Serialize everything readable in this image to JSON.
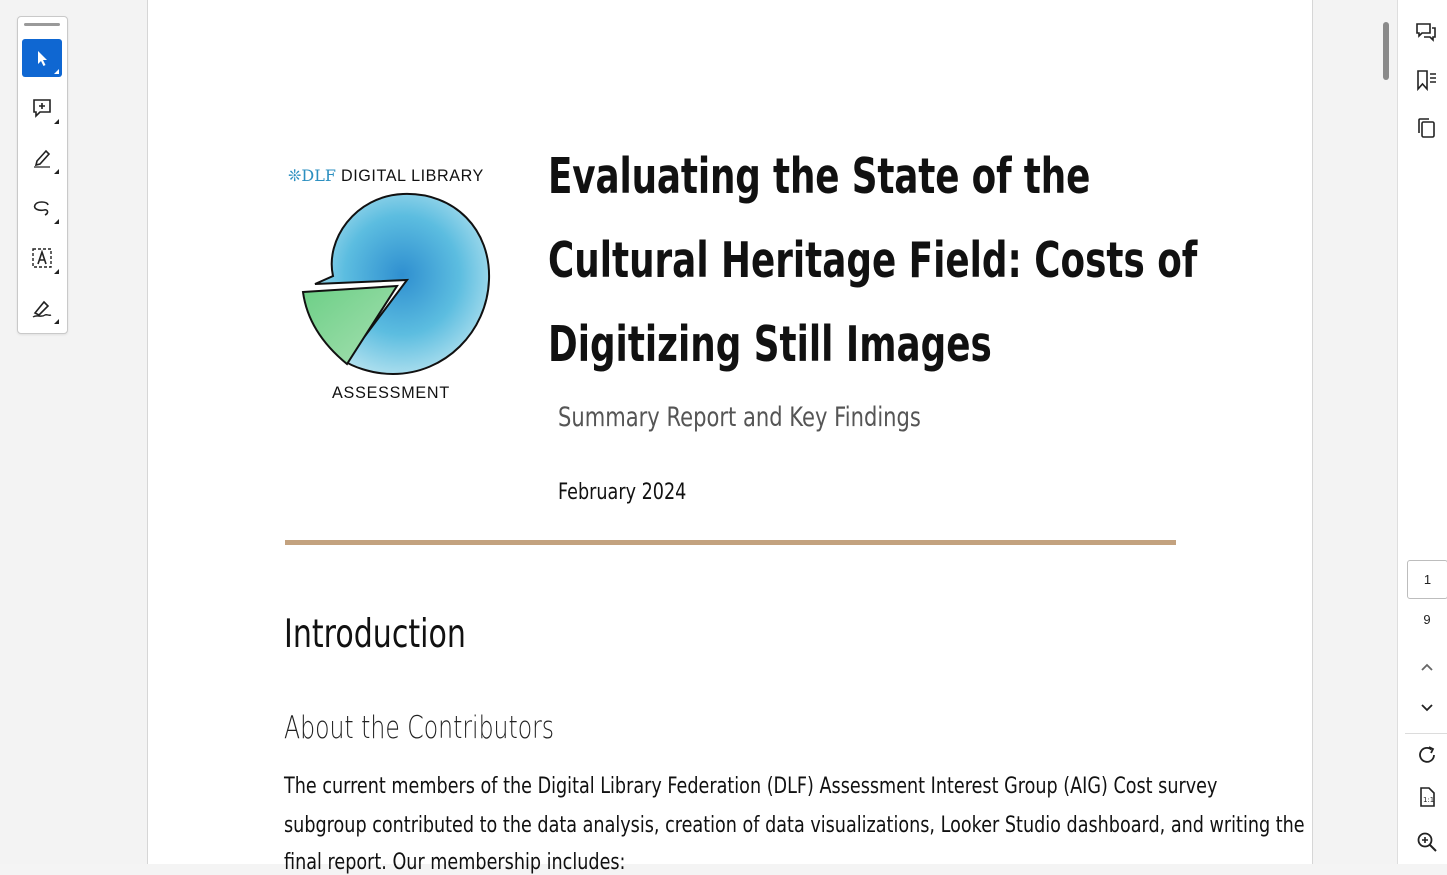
{
  "toolbar": {
    "tools": [
      {
        "name": "select",
        "icon": "cursor-icon",
        "active": true
      },
      {
        "name": "add-comment",
        "icon": "comment-plus-icon"
      },
      {
        "name": "highlight",
        "icon": "highlighter-icon"
      },
      {
        "name": "draw",
        "icon": "freehand-draw-icon"
      },
      {
        "name": "text-select",
        "icon": "text-box-icon"
      },
      {
        "name": "sign",
        "icon": "pen-sign-icon"
      }
    ]
  },
  "right_panel": {
    "icons": [
      "comments-icon",
      "bookmarks-icon",
      "page-thumbnails-icon"
    ],
    "current_page": "1",
    "total_pages": "9",
    "bottom_icons": [
      "chevron-up-icon",
      "chevron-down-icon",
      "rotate-icon",
      "fit-page-icon",
      "zoom-in-icon"
    ]
  },
  "document": {
    "logo": {
      "org_mark": "❊DLF",
      "org_name": "DIGITAL LIBRARY",
      "caption": "ASSESSMENT",
      "colors": {
        "circle": "#5fb8dc",
        "slice": "#7ccf8c"
      }
    },
    "title_lines": [
      "Evaluating the State of the",
      "Cultural Heritage Field: Costs of",
      "Digitizing Still Images"
    ],
    "subtitle": "Summary Report and Key Findings",
    "date": "February 2024",
    "rule_color": "#c3a27f",
    "heading_intro": "Introduction",
    "heading_about": "About the Contributors",
    "paragraph_lines": [
      "The current members of the Digital Library Federation (DLF) Assessment Interest Group (AIG) Cost survey",
      "subgroup contributed to the data analysis, creation of data visualizations, Looker Studio dashboard, and writing the",
      "final report. Our membership includes:"
    ]
  }
}
